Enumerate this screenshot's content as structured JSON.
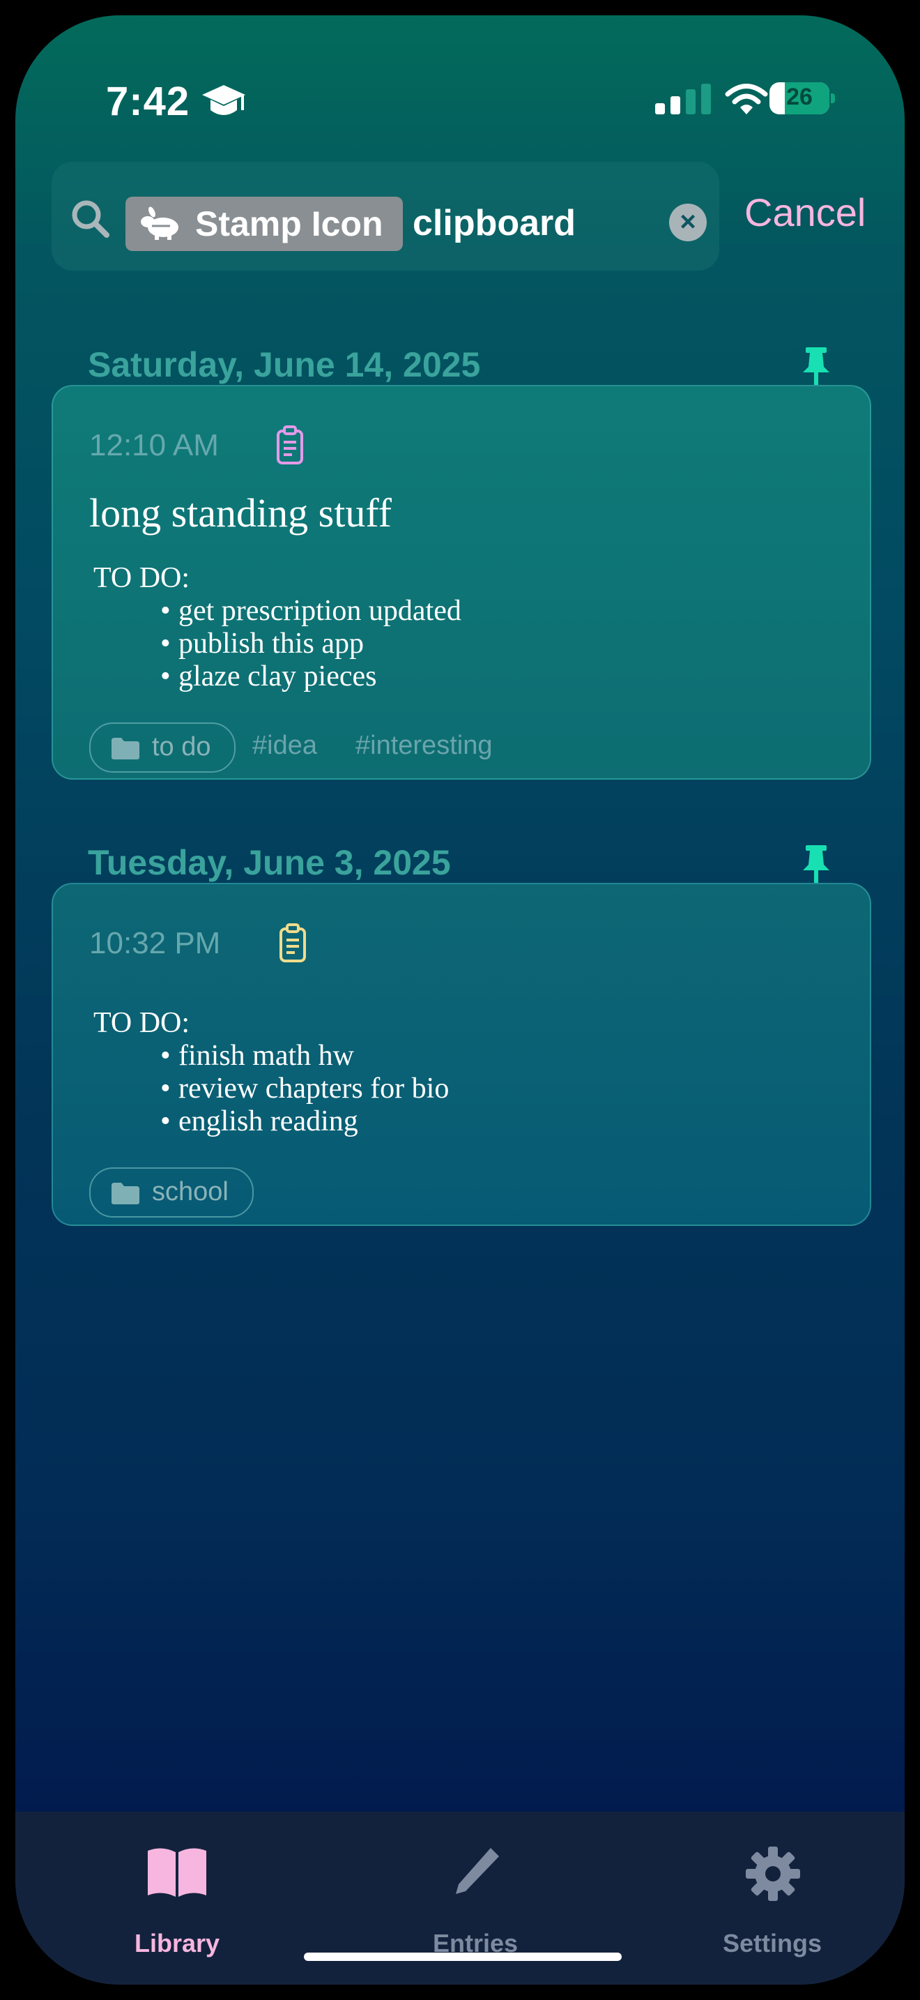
{
  "status_bar": {
    "time": "7:42",
    "battery": "26"
  },
  "search": {
    "token_label": "Stamp Icon",
    "query": "clipboard",
    "cancel_label": "Cancel"
  },
  "groups": [
    {
      "date": "Saturday, June 14, 2025",
      "entry": {
        "time": "12:10 AM",
        "clip_color": "#e49ae8",
        "title": "long standing stuff",
        "body_heading": "TO DO:",
        "items": [
          "get prescription updated",
          "publish this app",
          "glaze clay pieces"
        ],
        "folder": "to do",
        "tags": [
          "#idea",
          "#interesting"
        ]
      }
    },
    {
      "date": "Tuesday, June 3, 2025",
      "entry": {
        "time": "10:32 PM",
        "clip_color": "#f0dc8c",
        "body_heading": "TO DO:",
        "items": [
          "finish math hw",
          "review chapters for bio",
          "english reading"
        ],
        "folder": "school"
      }
    }
  ],
  "tab_bar": {
    "tabs": [
      {
        "label": "Library",
        "icon": "book-icon",
        "active": true
      },
      {
        "label": "Entries",
        "icon": "pencil-icon",
        "active": false
      },
      {
        "label": "Settings",
        "icon": "gear-icon",
        "active": false
      }
    ]
  },
  "colors": {
    "accent": "#f7b6df",
    "pin": "#19e0b2",
    "inactive_tab": "#7d8aa0"
  }
}
